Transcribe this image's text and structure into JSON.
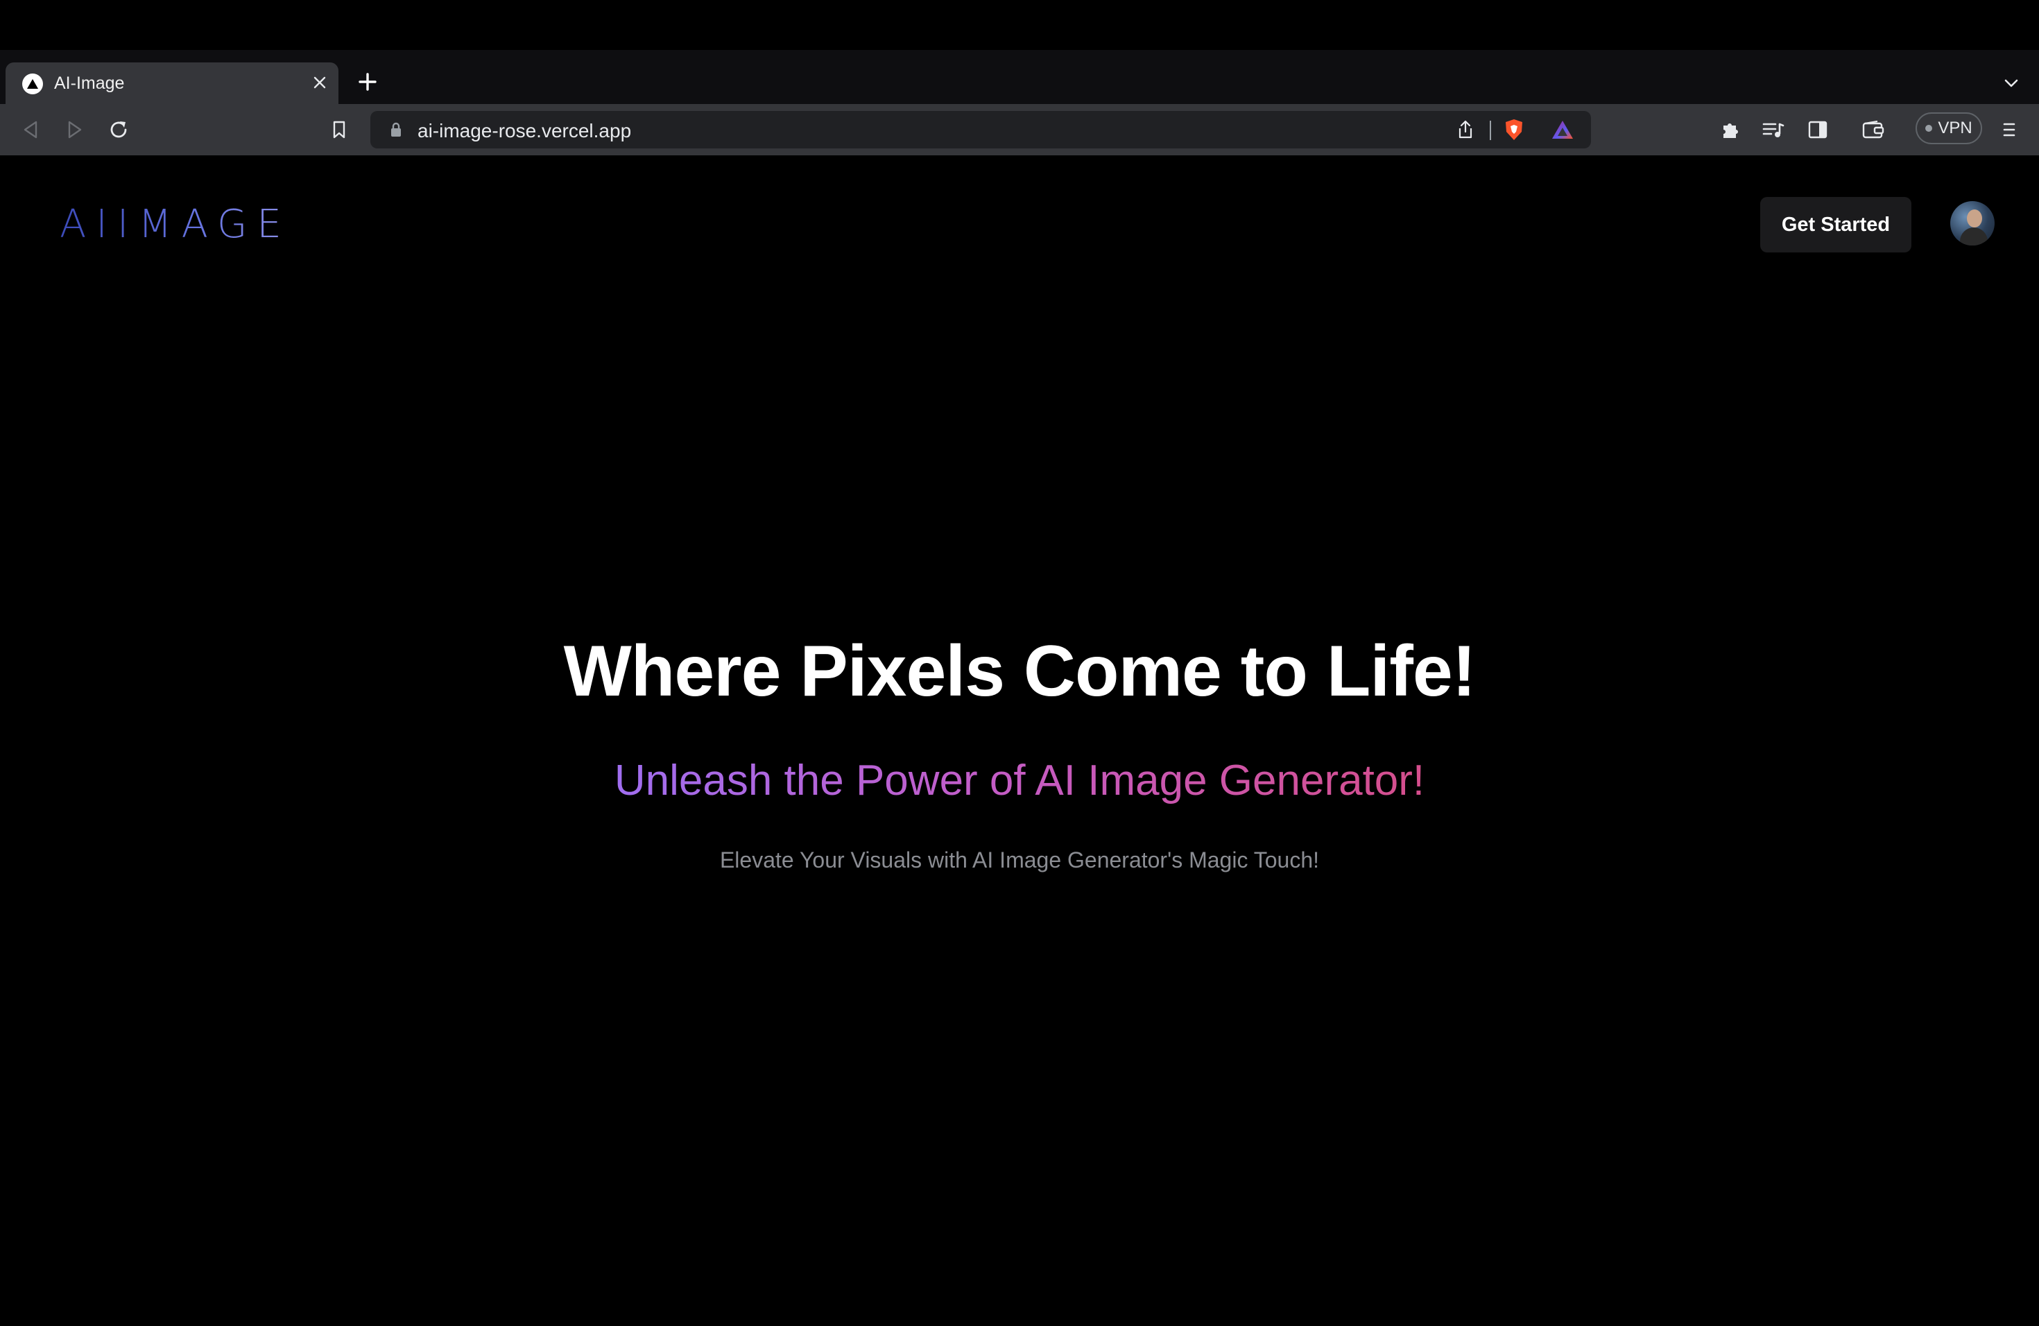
{
  "browser": {
    "tab": {
      "title": "AI-Image",
      "favicon": "triangle-logo-icon",
      "close_icon": "close-icon"
    },
    "new_tab_icon": "plus-icon",
    "tabs_dropdown_icon": "chevron-down-icon",
    "toolbar": {
      "back_icon": "back-arrow-icon",
      "forward_icon": "forward-arrow-icon",
      "reload_icon": "reload-icon",
      "bookmark_icon": "bookmark-icon",
      "url": "ai-image-rose.vercel.app",
      "lock_icon": "lock-icon",
      "share_icon": "share-icon",
      "brave_shield_icon": "brave-shield-icon",
      "rewards_icon": "brave-rewards-icon",
      "extensions_icon": "puzzle-icon",
      "playlist_icon": "playlist-icon",
      "sidebar_icon": "sidebar-icon",
      "wallet_icon": "wallet-icon",
      "vpn_label": "VPN",
      "menu_icon": "hamburger-menu-icon"
    }
  },
  "site": {
    "logo_text": "AIIMAGE",
    "nav": {
      "get_started_label": "Get Started",
      "avatar": "user-avatar"
    },
    "hero": {
      "headline": "Where Pixels Come to Life!",
      "subheadline": "Unleash the Power of AI Image Generator!",
      "tagline": "Elevate Your Visuals with AI Image Generator's Magic Touch!"
    }
  },
  "colors": {
    "page_background": "#000000",
    "toolbar_background": "#35363a",
    "logo_gradient": [
      "#3b4ab8",
      "#8b8fe8"
    ],
    "subheadline_gradient": [
      "#a06ef0",
      "#d54e8c"
    ],
    "tagline": "#8b8d93",
    "button_background": "#1b1b1d"
  }
}
